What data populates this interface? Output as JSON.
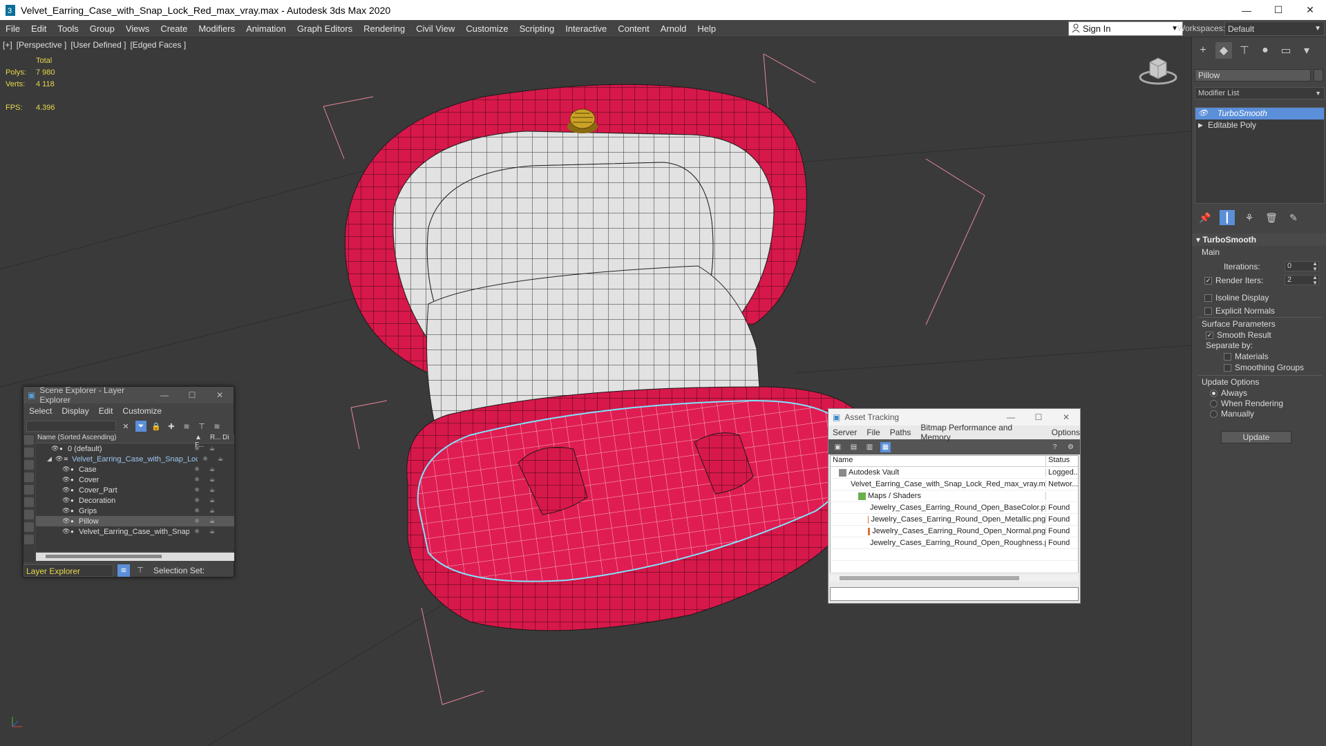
{
  "window": {
    "title": "Velvet_Earring_Case_with_Snap_Lock_Red_max_vray.max - Autodesk 3ds Max 2020",
    "minimize": "—",
    "maximize": "☐",
    "close": "✕"
  },
  "menu": {
    "items": [
      "File",
      "Edit",
      "Tools",
      "Group",
      "Views",
      "Create",
      "Modifiers",
      "Animation",
      "Graph Editors",
      "Rendering",
      "Civil View",
      "Customize",
      "Scripting",
      "Interactive",
      "Content",
      "Arnold",
      "Help"
    ],
    "sign_in": "Sign In",
    "workspaces_label": "Workspaces:",
    "workspace_value": "Default"
  },
  "viewport": {
    "labels": [
      "[+]",
      "[Perspective ]",
      "[User Defined ]",
      "[Edged Faces ]"
    ],
    "stats": {
      "total_label": "Total",
      "polys_label": "Polys:",
      "polys_value": "7 980",
      "verts_label": "Verts:",
      "verts_value": "4 118",
      "fps_label": "FPS:",
      "fps_value": "4.396"
    },
    "colors": {
      "background": "#3a3a3a",
      "velvet_red": "#d7184a",
      "lining_white": "#e4e4e4",
      "wire": "#1a1a1a",
      "selection_outline": "#7fe6ff",
      "bbox_pink": "#e8889a",
      "gold": "#c9a227"
    }
  },
  "command_panel": {
    "tabs": [
      "create-icon",
      "modify-icon",
      "hierarchy-icon",
      "motion-icon",
      "display-icon",
      "utilities-icon"
    ],
    "object_name": "Pillow",
    "modifier_list": "Modifier List",
    "stack": [
      {
        "label": "TurboSmooth",
        "selected": true
      },
      {
        "label": "Editable Poly",
        "selected": false
      }
    ],
    "rollout_title": "TurboSmooth",
    "main_label": "Main",
    "iterations_label": "Iterations:",
    "iterations_value": "0",
    "render_iters_label": "Render Iters:",
    "render_iters_value": "2",
    "isoline_label": "Isoline Display",
    "explicit_normals_label": "Explicit Normals",
    "surface_params_label": "Surface Parameters",
    "smooth_result_label": "Smooth Result",
    "separate_by_label": "Separate by:",
    "materials_label": "Materials",
    "smoothing_groups_label": "Smoothing Groups",
    "update_options_label": "Update Options",
    "always_label": "Always",
    "when_rendering_label": "When Rendering",
    "manually_label": "Manually",
    "update_button": "Update"
  },
  "scene_explorer": {
    "title": "Scene Explorer - Layer Explorer",
    "menu": [
      "Select",
      "Display",
      "Edit",
      "Customize"
    ],
    "col_name": "Name (Sorted Ascending)",
    "col_frozen": "▲ F...",
    "col_render": "R...",
    "col_display": "Di",
    "rows": [
      {
        "label": "0 (default)",
        "indent": 1,
        "selected": false
      },
      {
        "label": "Velvet_Earring_Case_with_Snap_Lock_Red",
        "indent": 0,
        "selected": false
      },
      {
        "label": "Case",
        "indent": 2,
        "selected": false
      },
      {
        "label": "Cover",
        "indent": 2,
        "selected": false
      },
      {
        "label": "Cover_Part",
        "indent": 2,
        "selected": false
      },
      {
        "label": "Decoration",
        "indent": 2,
        "selected": false
      },
      {
        "label": "Grips",
        "indent": 2,
        "selected": false
      },
      {
        "label": "Pillow",
        "indent": 2,
        "selected": true
      },
      {
        "label": "Velvet_Earring_Case_with_Snap_Lock_Red",
        "indent": 2,
        "selected": false
      }
    ],
    "footer_layer": "Layer Explorer",
    "selection_set_label": "Selection Set:"
  },
  "asset_tracking": {
    "title": "Asset Tracking",
    "menu": [
      "Server",
      "File",
      "Paths",
      "Bitmap Performance and Memory",
      "Options"
    ],
    "col_name": "Name",
    "col_status": "Status",
    "rows": [
      {
        "name": "Autodesk Vault",
        "status": "Logged...",
        "indent": 1
      },
      {
        "name": "Velvet_Earring_Case_with_Snap_Lock_Red_max_vray.max",
        "status": "Networ...",
        "indent": 2
      },
      {
        "name": "Maps / Shaders",
        "status": "",
        "indent": 3
      },
      {
        "name": "Jewelry_Cases_Earring_Round_Open_BaseColor.png",
        "status": "Found",
        "indent": 4
      },
      {
        "name": "Jewelry_Cases_Earring_Round_Open_Metallic.png",
        "status": "Found",
        "indent": 4
      },
      {
        "name": "Jewelry_Cases_Earring_Round_Open_Normal.png",
        "status": "Found",
        "indent": 4
      },
      {
        "name": "Jewelry_Cases_Earring_Round_Open_Roughness.png",
        "status": "Found",
        "indent": 4
      }
    ]
  }
}
